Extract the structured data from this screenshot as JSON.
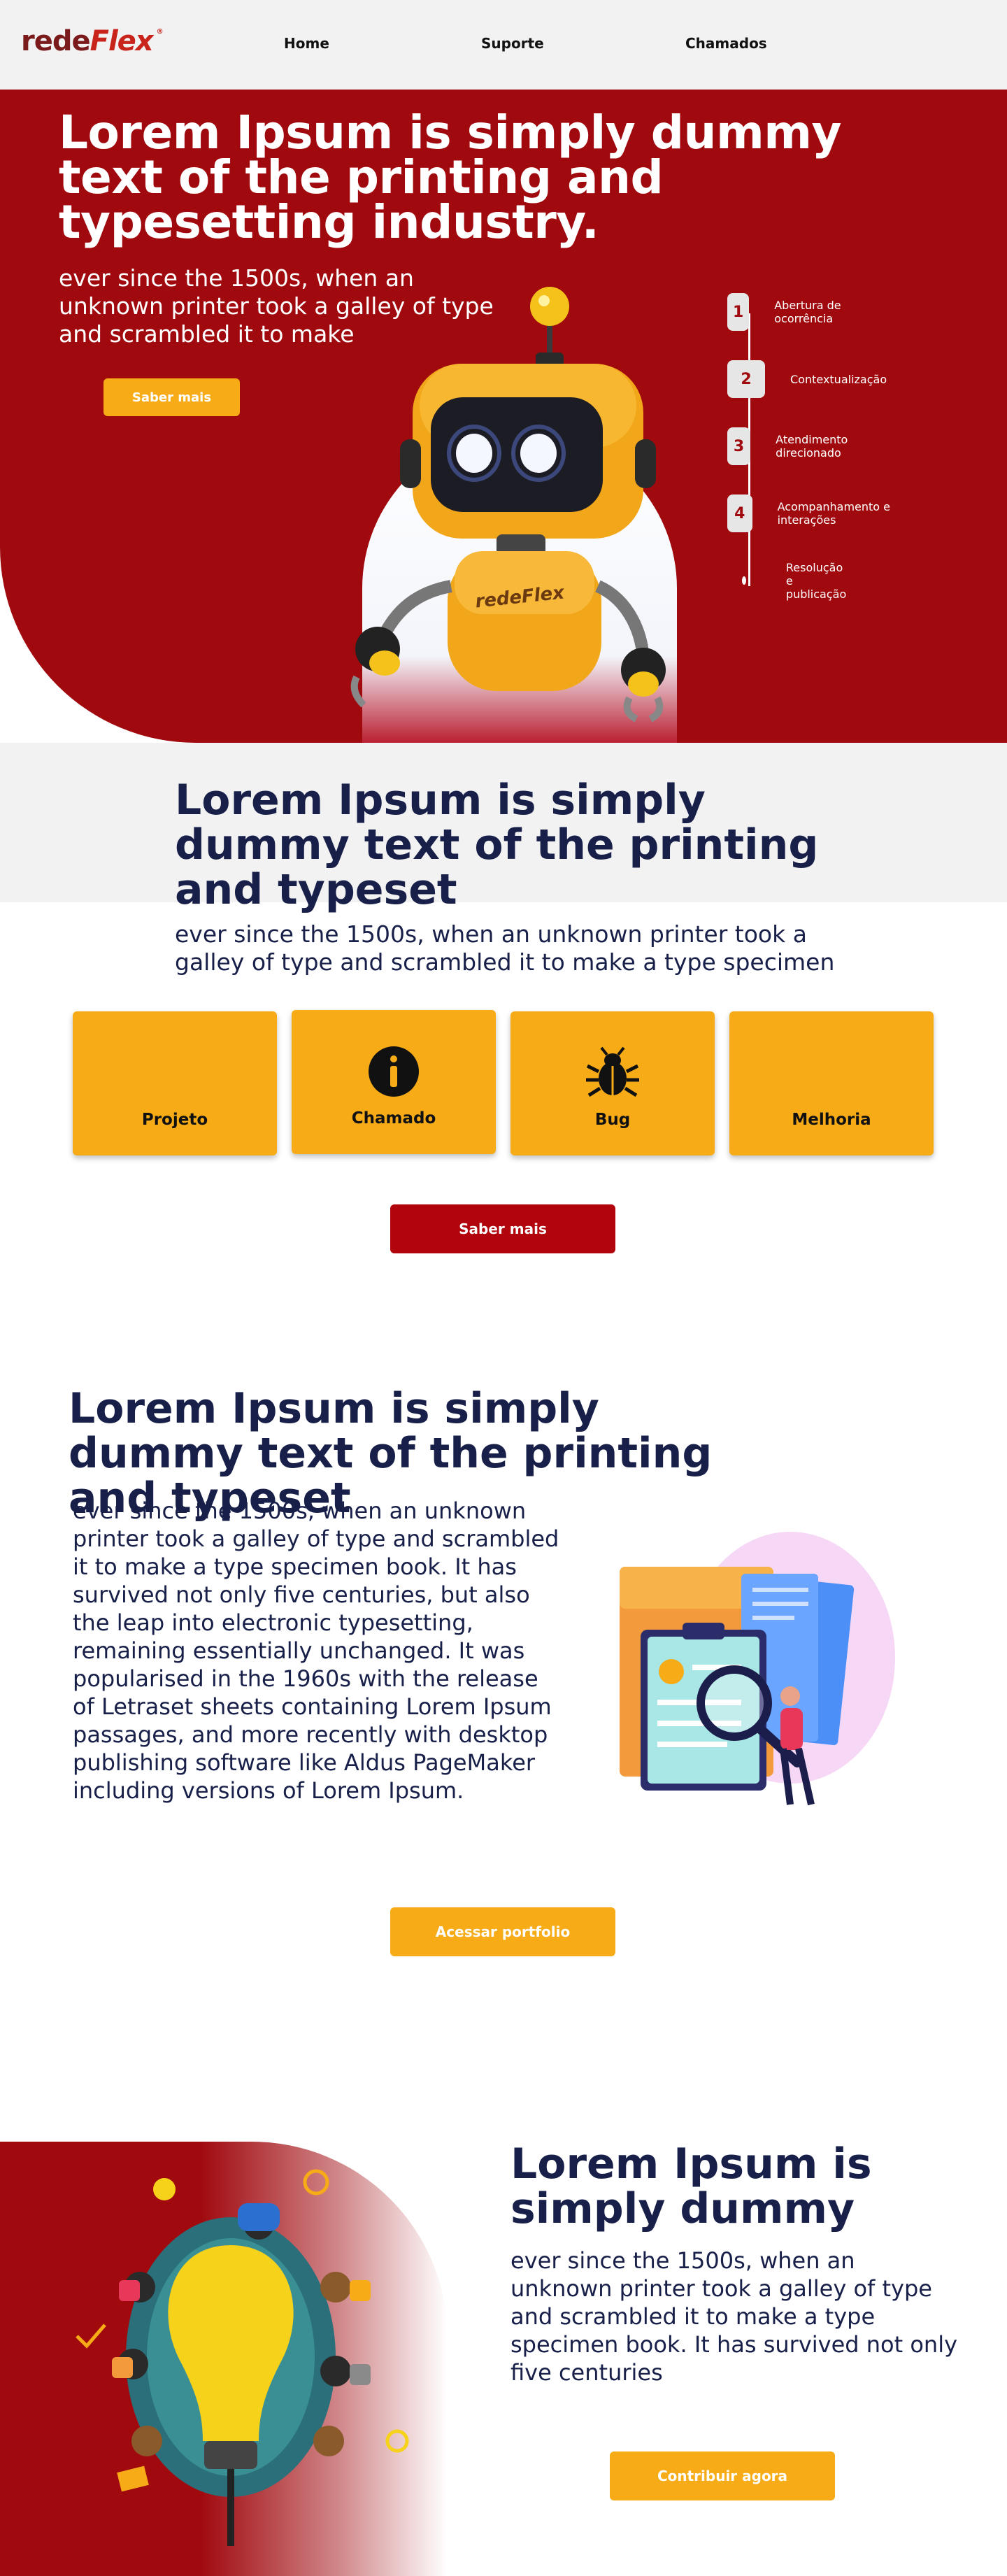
{
  "nav": {
    "logo_part1": "rede",
    "logo_part2": "Flex",
    "logo_mark": "®",
    "links": [
      "Home",
      "Suporte",
      "Chamados"
    ]
  },
  "hero": {
    "title": "Lorem Ipsum is simply dummy text of the printing and typesetting industry.",
    "subtitle": "ever since the 1500s, when an unknown printer took a galley of type and scrambled it to make",
    "button": "Saber mais",
    "robot_badge": "redeFlex",
    "steps": [
      {
        "num": "1",
        "label": "Abertura de ocorrência"
      },
      {
        "num": "2",
        "label": "Contextualização"
      },
      {
        "num": "3",
        "label": "Atendimento direcionado"
      },
      {
        "num": "4",
        "label": "Acompanhamento e interações"
      },
      {
        "num": "",
        "label": "Resolução e publicação"
      }
    ]
  },
  "section2": {
    "title": "Lorem Ipsum is simply dummy text of the printing and typeset",
    "subtitle": "ever since the 1500s, when an unknown printer took a galley of type and scrambled it to make a type specimen",
    "cards": [
      {
        "label": "Projeto",
        "icon": "none"
      },
      {
        "label": "Chamado",
        "icon": "info-icon"
      },
      {
        "label": "Bug",
        "icon": "bug-icon"
      },
      {
        "label": "Melhoria",
        "icon": "none"
      }
    ],
    "button": "Saber mais"
  },
  "section3": {
    "title": "Lorem Ipsum is simply dummy text of the printing and typeset",
    "body": "ever since the 1500s, when an unknown printer took a galley of type and scrambled it to make a type specimen book. It has survived not only five centuries, but also the leap into electronic typesetting, remaining essentially unchanged. It was popularised in the 1960s with the release of Letraset sheets containing Lorem Ipsum passages, and more recently with desktop publishing software like Aldus PageMaker including versions of Lorem Ipsum.",
    "button": "Acessar portfolio"
  },
  "section4": {
    "title": "Lorem Ipsum is simply dummy",
    "body": "ever since the 1500s, when an unknown printer took a galley of type and scrambled it to make a type specimen book. It has survived not only five centuries",
    "button": "Contribuir agora"
  },
  "colors": {
    "brand_red": "#a00a0f",
    "button_red": "#b2040c",
    "accent_yellow": "#f6ab17",
    "heading_navy": "#18204a",
    "nav_bg": "#f2f2f2"
  }
}
